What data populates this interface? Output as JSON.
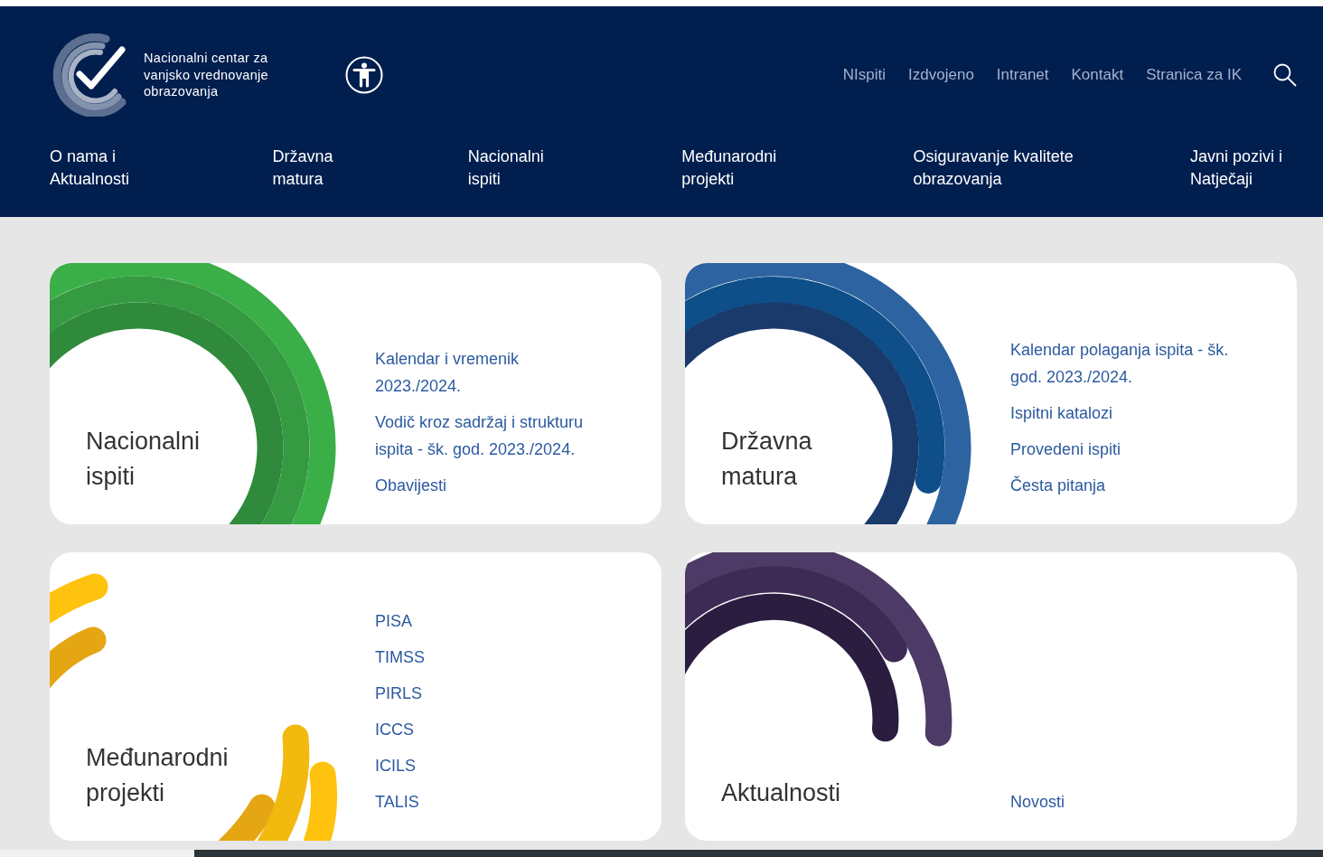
{
  "logo": {
    "text": "Nacionalni centar za vanjsko vrednovanje obrazovanja"
  },
  "top_links": [
    "NIspiti",
    "Izdvojeno",
    "Intranet",
    "Kontakt",
    "Stranica za IK"
  ],
  "main_nav": [
    "O nama i Aktualnosti",
    "Državna matura",
    "Nacionalni ispiti",
    "Međunarodni projekti",
    "Osiguravanje kvalitete obrazovanja",
    "Javni pozivi i Natječaji"
  ],
  "cards": [
    {
      "kind": "national",
      "title": "Nacionalni ispiti",
      "links": [
        "Kalendar i vremenik 2023./2024.",
        "Vodič kroz sadržaj i strukturu ispita - šk. god. 2023./2024.",
        "Obavijesti"
      ]
    },
    {
      "kind": "matura",
      "title": "Državna matura",
      "links": [
        "Kalendar polaganja ispita - šk. god. 2023./2024.",
        "Ispitni katalozi",
        "Provedeni ispiti",
        "Česta pitanja"
      ]
    },
    {
      "kind": "international",
      "title": "Međunarodni projekti",
      "links": [
        "PISA",
        "TIMSS",
        "PIRLS",
        "ICCS",
        "ICILS",
        "TALIS"
      ]
    },
    {
      "kind": "news",
      "title": "Aktualnosti",
      "links": [
        "Novosti"
      ]
    }
  ]
}
